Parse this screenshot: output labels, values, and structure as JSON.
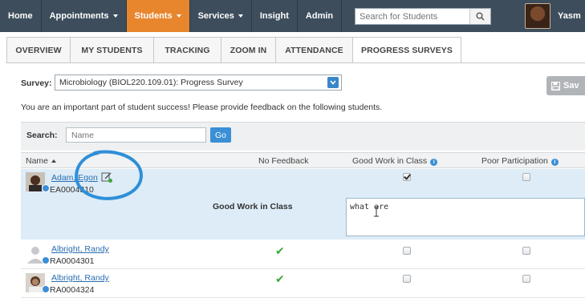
{
  "nav": {
    "items": [
      {
        "label": "Home",
        "caret": false,
        "active": false
      },
      {
        "label": "Appointments",
        "caret": true,
        "active": false
      },
      {
        "label": "Students",
        "caret": true,
        "active": true
      },
      {
        "label": "Services",
        "caret": true,
        "active": false
      },
      {
        "label": "Insight",
        "caret": false,
        "active": false
      },
      {
        "label": "Admin",
        "caret": false,
        "active": false
      }
    ],
    "search_placeholder": "Search for Students",
    "user_name": "Yasm",
    "colors": {
      "bar": "#3d4d5c",
      "active": "#e8862e"
    }
  },
  "tabs": [
    {
      "label": "OVERVIEW",
      "active": false
    },
    {
      "label": "MY STUDENTS",
      "active": false
    },
    {
      "label": "TRACKING",
      "active": false
    },
    {
      "label": "ZOOM IN",
      "active": false
    },
    {
      "label": "ATTENDANCE",
      "active": false
    },
    {
      "label": "PROGRESS SURVEYS",
      "active": true
    }
  ],
  "survey": {
    "label": "Survey:",
    "selected": "Microbiology (BIOL220.109.01): Progress Survey",
    "save_label": "Sav"
  },
  "intro": "You are an important part of student success! Please provide feedback on the following students.",
  "search": {
    "label": "Search:",
    "placeholder": "Name",
    "go_label": "Go"
  },
  "columns": {
    "name": "Name",
    "no_feedback": "No Feedback",
    "good_work": "Good Work in Class",
    "poor_participation": "Poor Participation"
  },
  "students": [
    {
      "name": "Adam, Egon",
      "id": "EA0004310",
      "no_feedback": false,
      "good_work": true,
      "poor_participation": false
    },
    {
      "name": "Albright, Randy",
      "id": "RA0004301",
      "no_feedback": true,
      "good_work": false,
      "poor_participation": false
    },
    {
      "name": "Albright, Randy",
      "id": "RA0004324",
      "no_feedback": true,
      "good_work": false,
      "poor_participation": false
    }
  ],
  "expanded": {
    "label": "Good Work in Class",
    "comment": "what are"
  },
  "colors": {
    "accent": "#3a8fd6",
    "highlight_row": "#ddecf7",
    "annotation": "#2f8fd8",
    "check": "#3aa83a"
  }
}
